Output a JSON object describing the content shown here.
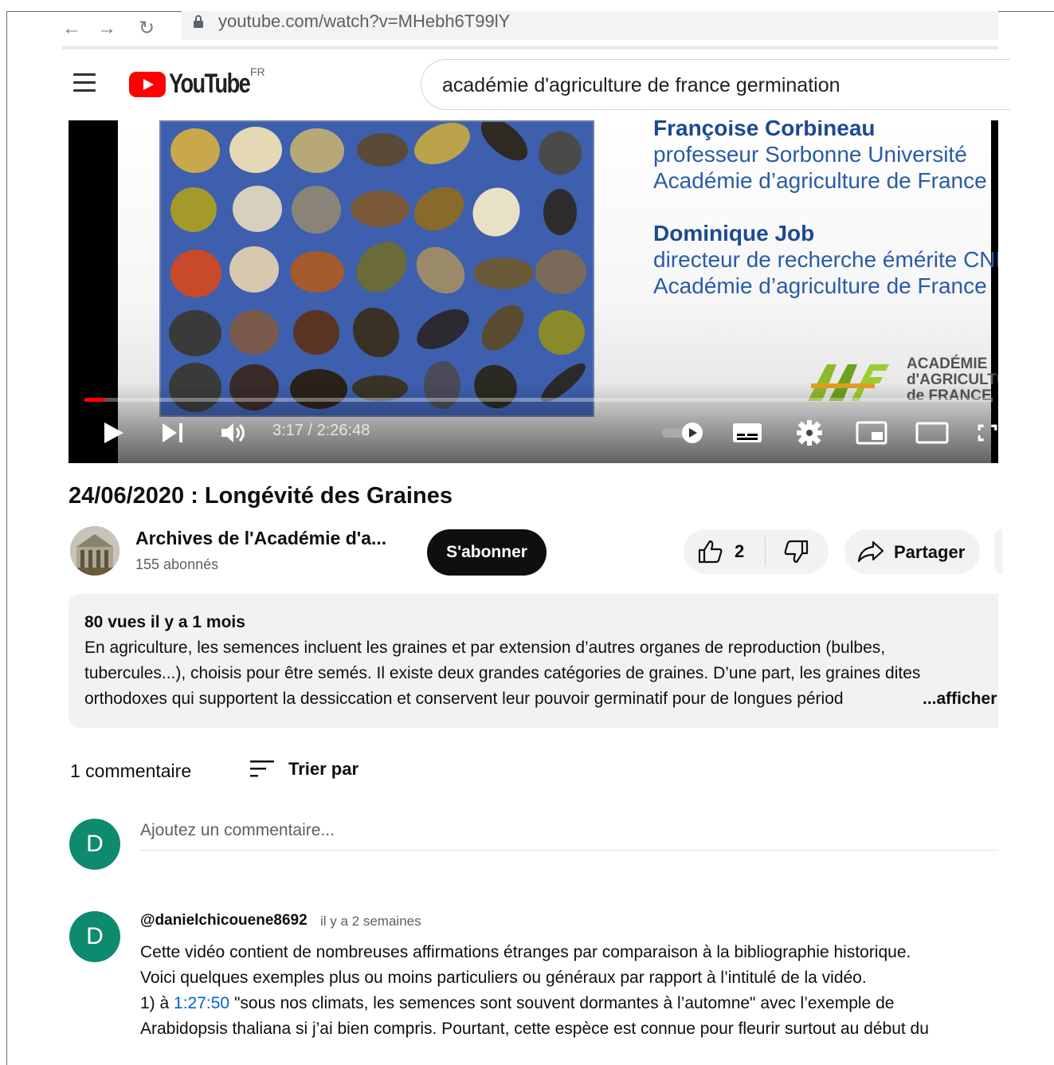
{
  "browser": {
    "url": "youtube.com/watch?v=MHebh6T99lY"
  },
  "header": {
    "logo_text": "YouTube",
    "country": "FR",
    "search_value": "académie d'agriculture de france germination"
  },
  "player": {
    "slide": {
      "name1": "Françoise Corbineau",
      "title1": "professeur Sorbonne Université",
      "org1": "Académie d’agriculture de France",
      "name2": "Dominique Job",
      "title2": "directeur de recherche émérite CNRS",
      "org2": "Académie d’agriculture de France",
      "logo_text": "ACADÉMIE\nd'AGRICULTURE\nde FRANCE"
    },
    "time_display": "3:17 / 2:26:48",
    "progress": 0.023
  },
  "video": {
    "title": "24/06/2020 : Longévité des Graines",
    "channel_name": "Archives de l'Académie d'a...",
    "subscribers": "155 abonnés",
    "subscribe_label": "S'abonner",
    "likes": "2",
    "share_label": "Partager"
  },
  "description": {
    "meta": "80 vues  il y a 1 mois",
    "lines": [
      "En agriculture, les semences incluent les graines et par extension d’autres organes de reproduction (bulbes,",
      "tubercules...), choisis pour être semés. Il existe deux grandes catégories de graines. D’une part, les graines dites",
      "orthodoxes qui supportent la dessiccation et conservent leur pouvoir germinatif pour de longues périod"
    ],
    "more_label": "...afficher p"
  },
  "comments": {
    "count_label": "1 commentaire",
    "sort_label": "Trier par",
    "user_initial": "D",
    "add_placeholder": "Ajoutez un commentaire...",
    "items": [
      {
        "initial": "D",
        "author": "@danielchicouene8692",
        "time": "il y a 2 semaines",
        "line1": "Cette vidéo contient de nombreuses affirmations étranges par comparaison à la bibliographie historique.",
        "line2": "Voici quelques exemples plus ou moins particuliers ou généraux par rapport à l’intitulé de la vidéo.",
        "line3_prefix": "1) à ",
        "line3_link": "1:27:50",
        "line3_suffix": " \"sous nos climats, les semences sont souvent dormantes à l’automne\" avec l’exemple de",
        "line4": "Arabidopsis thaliana si j’ai bien compris. Pourtant, cette espèce est connue pour fleurir surtout au début du"
      }
    ]
  },
  "colors": {
    "brand_red": "#ff0000",
    "link_blue": "#065fd4",
    "avatar_green": "#0e8a6e",
    "slide_blue": "#1f4e96"
  }
}
